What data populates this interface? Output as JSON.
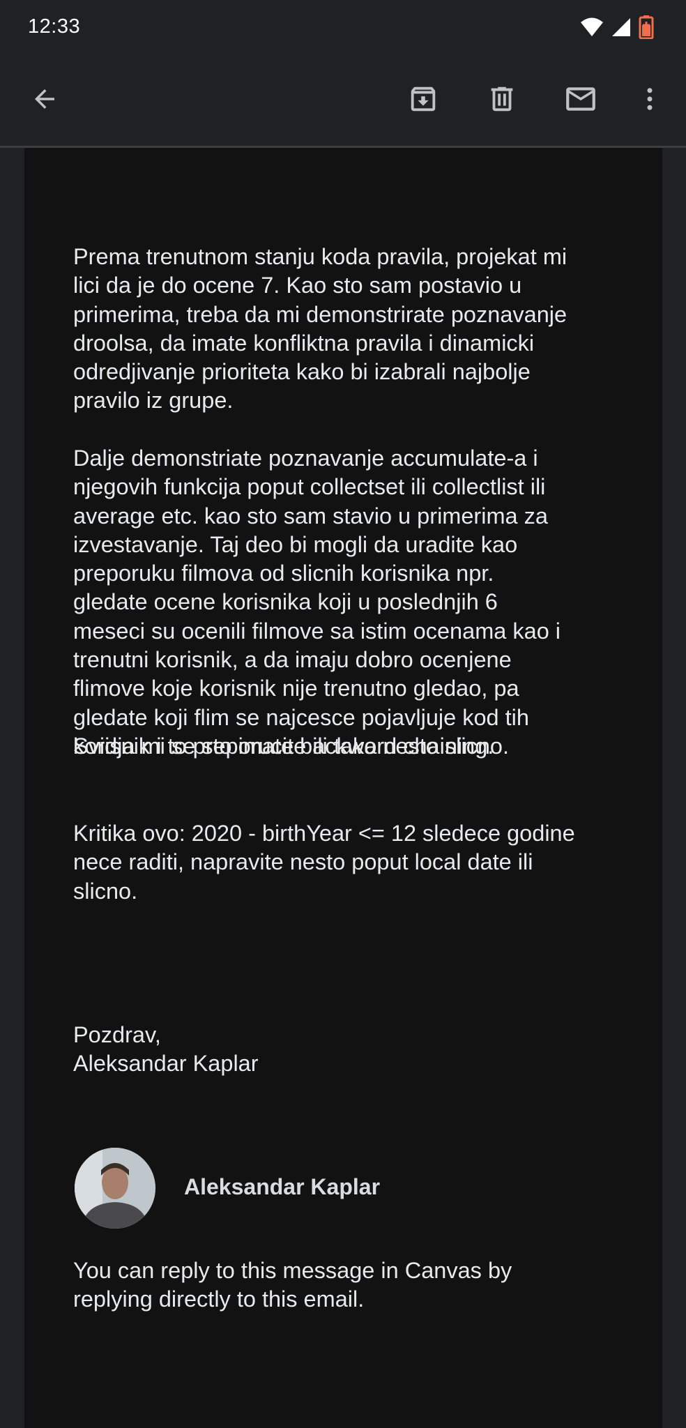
{
  "status_bar": {
    "time": "12:33",
    "icons": [
      "wifi-icon",
      "cellular-signal-icon",
      "battery-saver-icon"
    ],
    "battery_color": "#f06e4a"
  },
  "toolbar": {
    "actions": [
      "back-arrow-icon",
      "archive-icon",
      "delete-icon",
      "mark-unread-icon",
      "more-options-icon"
    ]
  },
  "email": {
    "paragraphs": [
      "Prema trenutnom stanju koda pravila, projekat mi\nlici da je do ocene 7. Kao sto sam postavio u\nprimerima, treba da mi demonstrirate poznavanje\ndroolsa, da imate konfliktna pravila i dinamicki\nodredjivanje prioriteta kako bi izabrali najbolje\npravilo iz grupe.",
      "Dalje demonstriate poznavanje accumulate-a i\nnjegovih funkcija poput collectset ili collectlist ili\naverage etc. kao sto sam stavio u primerima za\nizvestavanje. Taj deo bi mogli da uradite kao\npreporuku filmova od slicnih korisnika npr.\ngledate ocene korisnika koji u poslednjih 6\nmeseci su ocenili filmove sa istim ocenama kao i\ntrenutni korisnik, a da imaju dobro ocenjene\nflimove koje korisnik nije trenutno gledao, pa\ngledate koji flim se najcesce pojavljuje kod tih\nkorisnik i to preporucite ili tako nesto slicno.",
      "Svidja mi se sto imate backward chaining.",
      "Kritika ovo: 2020 - birthYear <= 12 sledece godine\nnece raditi, napravite nesto poput local date ili\nslicno.",
      "Pozdrav,\nAleksandar Kaplar"
    ],
    "sender_name": "Aleksandar Kaplar",
    "footer": "You can reply to this message in Canvas by\nreplying directly to this email."
  },
  "colors": {
    "background": "#202124",
    "card": "#121212",
    "text": "#e8eaed"
  }
}
